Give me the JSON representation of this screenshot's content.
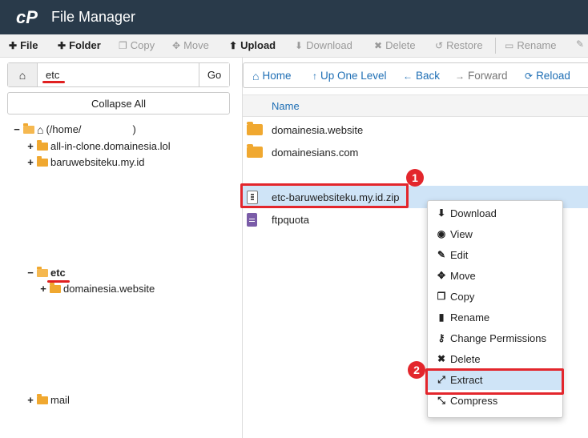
{
  "app": {
    "title": "File Manager",
    "logo_text": "cP"
  },
  "toolbar": {
    "items": [
      {
        "label": "File",
        "icon": "plus-icon",
        "enabled": true
      },
      {
        "label": "Folder",
        "icon": "plus-icon",
        "enabled": true
      },
      {
        "label": "Copy",
        "icon": "copy-icon",
        "enabled": false
      },
      {
        "label": "Move",
        "icon": "move-icon",
        "enabled": false
      },
      {
        "label": "Upload",
        "icon": "upload-icon",
        "enabled": true
      },
      {
        "label": "Download",
        "icon": "download-icon",
        "enabled": false
      },
      {
        "label": "Delete",
        "icon": "delete-icon",
        "enabled": false
      },
      {
        "label": "Restore",
        "icon": "restore-icon",
        "enabled": false
      },
      {
        "label": "Rename",
        "icon": "rename-icon",
        "enabled": false
      }
    ]
  },
  "left": {
    "path_value": "etc",
    "go_label": "Go",
    "collapse_label": "Collapse All",
    "tree": {
      "root_label": "(/home/",
      "root_suffix": ")",
      "items": [
        {
          "label": "all-in-clone.domainesia.lol"
        },
        {
          "label": "baruwebsiteku.my.id"
        },
        {
          "label": "etc"
        },
        {
          "label": "domainesia.website"
        },
        {
          "label": "mail"
        }
      ]
    }
  },
  "nav": {
    "home": "Home",
    "up": "Up One Level",
    "back": "Back",
    "forward": "Forward",
    "reload": "Reload"
  },
  "files": {
    "header": "Name",
    "rows": [
      {
        "name": "domainesia.website",
        "type": "folder"
      },
      {
        "name": "domainesians.com",
        "type": "folder"
      },
      {
        "name": "etc-baruwebsiteku.my.id.zip",
        "type": "zip"
      },
      {
        "name": "ftpquota",
        "type": "file"
      }
    ]
  },
  "context_menu": {
    "items": [
      {
        "label": "Download",
        "icon": "download-icon"
      },
      {
        "label": "View",
        "icon": "eye-icon"
      },
      {
        "label": "Edit",
        "icon": "pencil-icon"
      },
      {
        "label": "Move",
        "icon": "move-icon"
      },
      {
        "label": "Copy",
        "icon": "copy-icon"
      },
      {
        "label": "Rename",
        "icon": "rename-icon"
      },
      {
        "label": "Change Permissions",
        "icon": "key-icon"
      },
      {
        "label": "Delete",
        "icon": "delete-icon"
      },
      {
        "label": "Extract",
        "icon": "expand-icon"
      },
      {
        "label": "Compress",
        "icon": "compress-icon"
      }
    ]
  },
  "annotations": {
    "step1": "1",
    "step2": "2"
  },
  "colors": {
    "titlebar": "#293a4a",
    "link": "#1f6fb5",
    "highlight": "#e3262c",
    "selected": "#cfe4f7",
    "folder": "#f0a830"
  }
}
